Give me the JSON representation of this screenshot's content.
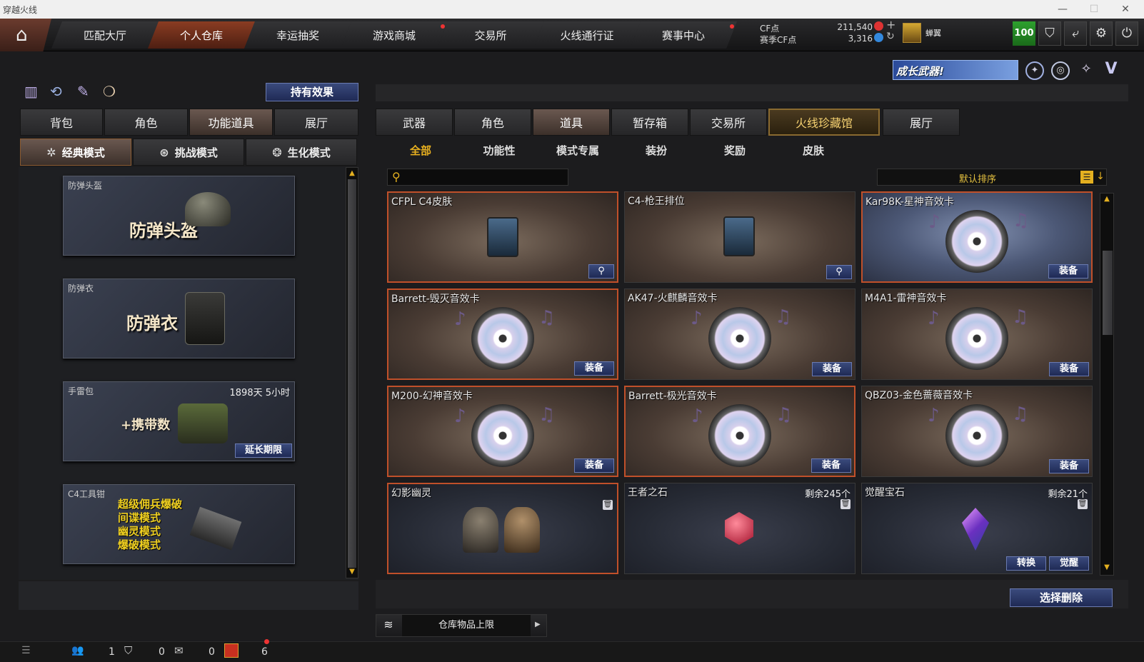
{
  "window": {
    "title": "穿越火线"
  },
  "topnav": {
    "tabs": [
      {
        "label": "匹配大厅",
        "active": false,
        "dot": false
      },
      {
        "label": "个人仓库",
        "active": true,
        "dot": false
      },
      {
        "label": "幸运抽奖",
        "active": false,
        "dot": false
      },
      {
        "label": "游戏商城",
        "active": false,
        "dot": true
      },
      {
        "label": "交易所",
        "active": false,
        "dot": false
      },
      {
        "label": "火线通行证",
        "active": false,
        "dot": false
      },
      {
        "label": "赛事中心",
        "active": false,
        "dot": true
      }
    ],
    "cf_label": "CF点",
    "cf_value": "211,540",
    "season_label": "赛季CF点",
    "season_value": "3,316",
    "player_name": "蝉翼",
    "level": "100"
  },
  "toolbar": {
    "effect_button": "持有效果"
  },
  "left_tabs": [
    "背包",
    "角色",
    "功能道具",
    "展厅"
  ],
  "left_active_tab": 2,
  "mode_tabs": [
    "经典模式",
    "挑战模式",
    "生化模式"
  ],
  "left_items": [
    {
      "label": "防弹头盔",
      "title": "防弹头盔"
    },
    {
      "label": "防弹衣",
      "title": "防弹衣"
    },
    {
      "label": "手雷包",
      "title": "+携带数",
      "time": "1898天 5小时",
      "button": "延长期限"
    },
    {
      "label": "C4工具钳",
      "lines": [
        "超级佣兵爆破",
        "间谍模式",
        "幽灵模式",
        "爆破模式"
      ]
    }
  ],
  "banner": {
    "text": "成长武器!"
  },
  "main_tabs": [
    "武器",
    "角色",
    "道具",
    "暂存箱",
    "交易所",
    "火线珍藏馆",
    "展厅"
  ],
  "main_active_tab": 5,
  "sub_tabs": [
    "全部",
    "功能性",
    "模式专属",
    "装扮",
    "奖励",
    "皮肤"
  ],
  "search": {
    "placeholder": ""
  },
  "sort": {
    "label": "默认排序"
  },
  "items": [
    {
      "name": "CFPL C4皮肤",
      "kind": "c4",
      "bg": "brown",
      "selected": true,
      "action": "magnify"
    },
    {
      "name": "C4-枪王排位",
      "kind": "c4",
      "bg": "brown",
      "selected": false,
      "action": "magnify"
    },
    {
      "name": "Kar98K-星神音效卡",
      "kind": "disc",
      "bg": "blue",
      "selected": true,
      "action": "装备"
    },
    {
      "name": "Barrett-毁灭音效卡",
      "kind": "disc",
      "bg": "brown",
      "selected": true,
      "action": "装备"
    },
    {
      "name": "AK47-火麒麟音效卡",
      "kind": "disc",
      "bg": "brown",
      "selected": false,
      "action": "装备"
    },
    {
      "name": "M4A1-雷神音效卡",
      "kind": "disc",
      "bg": "brown",
      "selected": false,
      "action": "装备"
    },
    {
      "name": "M200-幻神音效卡",
      "kind": "disc",
      "bg": "brown",
      "selected": true,
      "action": "装备"
    },
    {
      "name": "Barrett-极光音效卡",
      "kind": "disc",
      "bg": "brown",
      "selected": true,
      "action": "装备"
    },
    {
      "name": "QBZ03-金色蔷薇音效卡",
      "kind": "disc",
      "bg": "brown",
      "selected": false,
      "action": "装备"
    },
    {
      "name": "幻影幽灵",
      "kind": "ghost",
      "bg": "dark",
      "selected": true,
      "action": "trash"
    },
    {
      "name": "王者之石",
      "kind": "ruby",
      "bg": "dark",
      "selected": false,
      "action": "trash",
      "count": "剩余245个"
    },
    {
      "name": "觉醒宝石",
      "kind": "gem",
      "bg": "dark",
      "selected": false,
      "action": "trash",
      "count": "剩余21个",
      "buttons": [
        "转换",
        "觉醒"
      ]
    }
  ],
  "bottom": {
    "delete_button": "选择删除",
    "capacity_label": "仓库物品上限"
  },
  "statusbar": {
    "friends": "1",
    "shield": "0",
    "chat": "0",
    "gift": "6"
  }
}
